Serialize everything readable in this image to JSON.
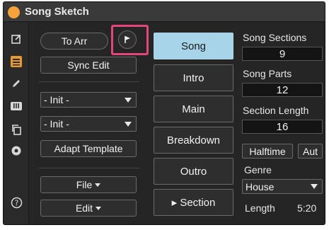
{
  "window": {
    "title": "Song Sketch",
    "dot_color": "#f5a23a"
  },
  "sidebar": {
    "icons": [
      "open-external-icon",
      "list-view-icon",
      "pencil-icon",
      "piano-keys-icon",
      "copy-icon",
      "gear-icon",
      "help-icon"
    ]
  },
  "left": {
    "to_arr_label": "To Arr",
    "sync_edit_label": "Sync Edit",
    "init_dropdown_1": "- Init -",
    "init_dropdown_2": "- Init -",
    "adapt_template_label": "Adapt Template",
    "file_menu_label": "File",
    "edit_menu_label": "Edit"
  },
  "middle": {
    "buttons": [
      {
        "label": "Song",
        "active": true
      },
      {
        "label": "Intro",
        "active": false
      },
      {
        "label": "Main",
        "active": false
      },
      {
        "label": "Breakdown",
        "active": false
      },
      {
        "label": "Outro",
        "active": false
      },
      {
        "label": "▸ Section",
        "active": false
      }
    ]
  },
  "right": {
    "song_sections_label": "Song Sections",
    "song_sections_value": "9",
    "song_parts_label": "Song Parts",
    "song_parts_value": "12",
    "section_length_label": "Section Length",
    "section_length_value": "16",
    "halftime_label": "Halftime",
    "aut_label": "Aut",
    "genre_label": "Genre",
    "genre_value": "House",
    "length_label": "Length",
    "length_value": "5:20"
  },
  "colors": {
    "accent_song": "#a7d4e8",
    "highlight": "#e4467a",
    "window_bg": "#252525"
  }
}
